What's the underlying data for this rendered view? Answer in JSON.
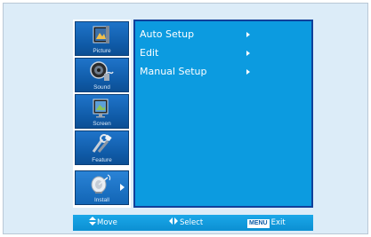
{
  "sidebar": {
    "items": [
      {
        "label": "Picture",
        "icon": "picture-icon"
      },
      {
        "label": "Sound",
        "icon": "sound-icon"
      },
      {
        "label": "Screen",
        "icon": "screen-icon"
      },
      {
        "label": "Feature",
        "icon": "feature-icon"
      },
      {
        "label": "Install",
        "icon": "install-icon",
        "selected": true
      }
    ]
  },
  "menu": {
    "items": [
      {
        "label": "Auto Setup"
      },
      {
        "label": "Edit"
      },
      {
        "label": "Manual Setup"
      }
    ]
  },
  "footer": {
    "move": "Move",
    "select": "Select",
    "menu_key": "MENU",
    "exit": "Exit"
  },
  "colors": {
    "panel": "#0c9be0",
    "sidebar_tile": "#1265b5",
    "background": "#dcecf8"
  }
}
